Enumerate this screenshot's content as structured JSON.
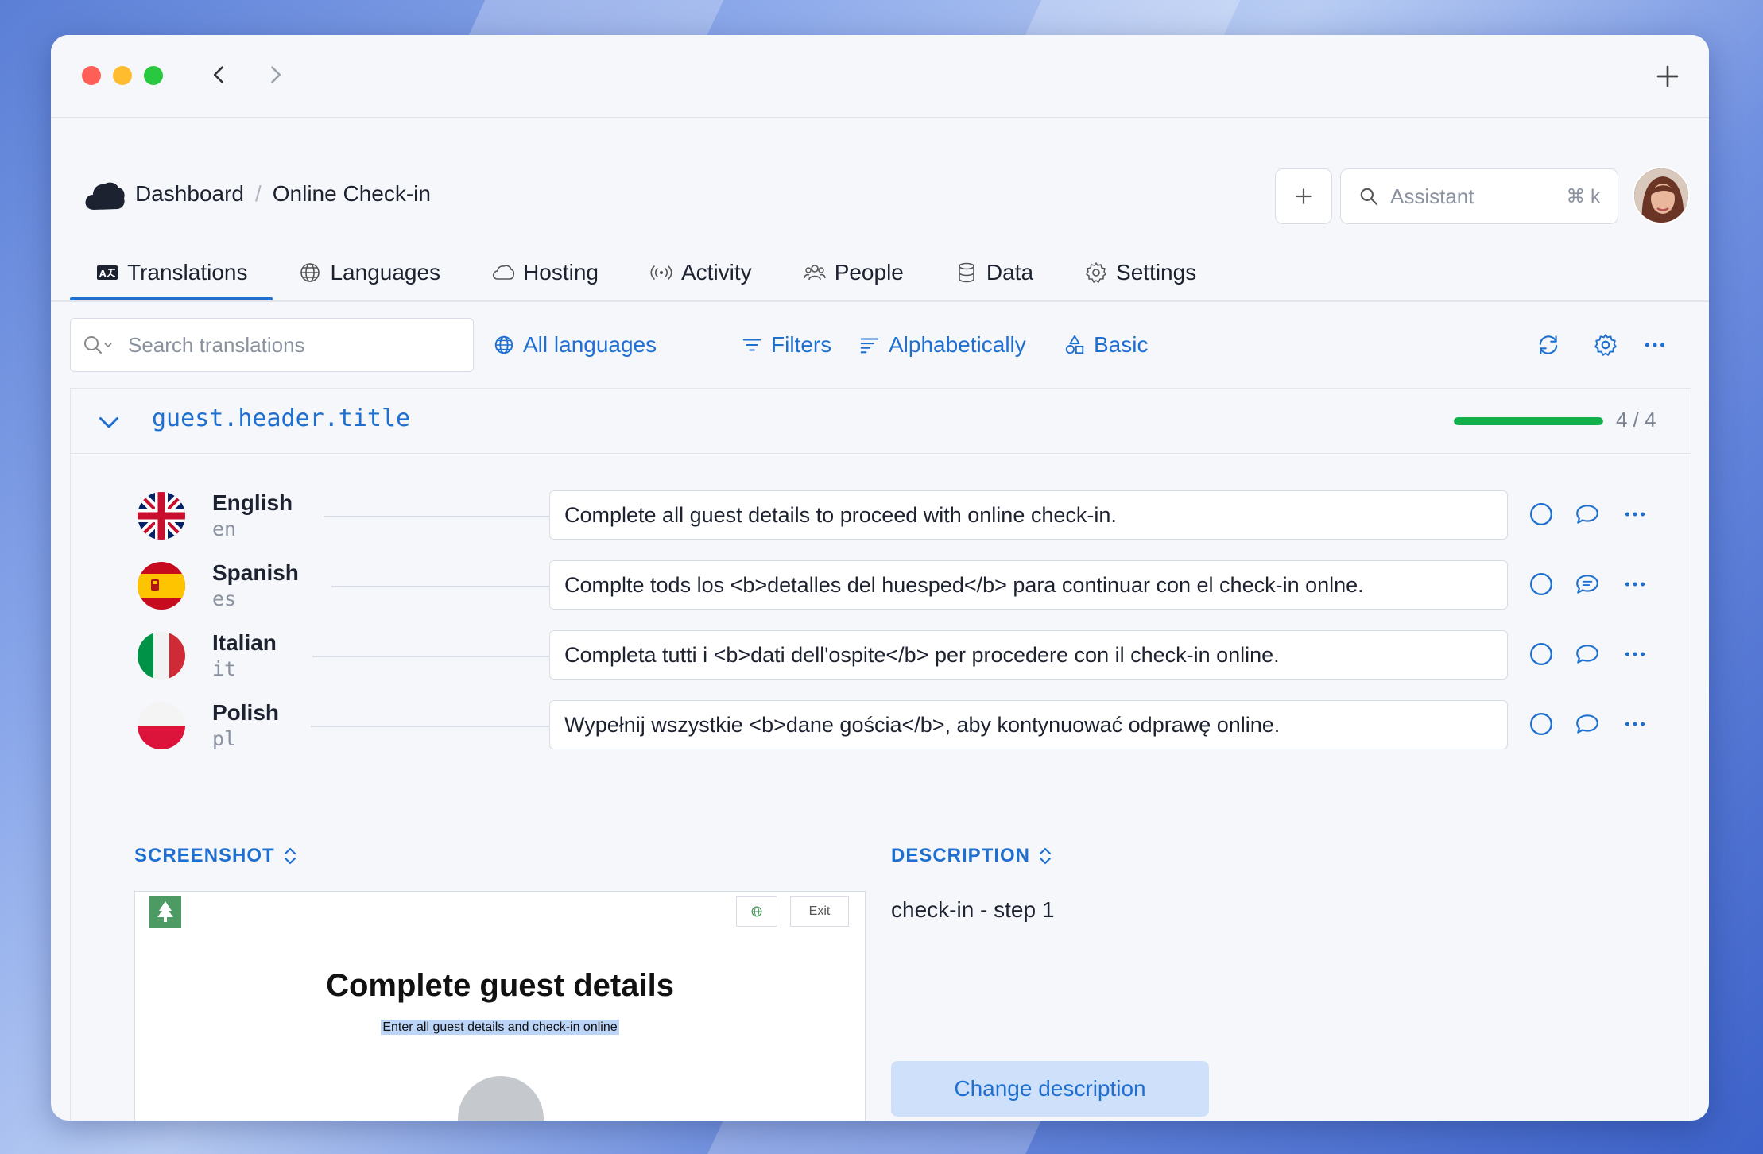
{
  "window": {
    "controls": [
      "close",
      "minimize",
      "zoom"
    ],
    "nav": {
      "back_icon": "chevron-left-icon",
      "forward_icon": "chevron-right-icon"
    },
    "new_tab_icon": "plus-icon"
  },
  "header": {
    "breadcrumb": {
      "root": "Dashboard",
      "separator": "/",
      "current": "Online Check-in"
    },
    "assistant": {
      "placeholder": "Assistant",
      "shortcut": "⌘ k"
    }
  },
  "tabs": [
    {
      "label": "Translations",
      "icon": "translate-icon",
      "active": true
    },
    {
      "label": "Languages",
      "icon": "globe-icon"
    },
    {
      "label": "Hosting",
      "icon": "cloud-icon"
    },
    {
      "label": "Activity",
      "icon": "broadcast-icon"
    },
    {
      "label": "People",
      "icon": "people-icon"
    },
    {
      "label": "Data",
      "icon": "database-icon"
    },
    {
      "label": "Settings",
      "icon": "gear-icon"
    }
  ],
  "toolbar": {
    "search_placeholder": "Search translations",
    "languages": "All languages",
    "filters": "Filters",
    "sort": "Alphabetically",
    "view": "Basic"
  },
  "key": {
    "name": "guest.header.title",
    "progress_text": "4 / 4",
    "progress_fraction": 1.0,
    "progress_color": "#12b04a",
    "rows": [
      {
        "language": "English",
        "code": "en",
        "flag": "uk-flag-icon",
        "text": "Complete all guest details to proceed with online check-in."
      },
      {
        "language": "Spanish",
        "code": "es",
        "flag": "spain-flag-icon",
        "text": "Complte tods los <b>detalles del huesped</b> para continuar con el check-in onlne."
      },
      {
        "language": "Italian",
        "code": "it",
        "flag": "italy-flag-icon",
        "text": "Completa tutti i <b>dati dell'ospite</b> per procedere con il check-in online."
      },
      {
        "language": "Polish",
        "code": "pl",
        "flag": "poland-flag-icon",
        "text": "Wypełnij wszystkie <b>dane gościa</b>, aby kontynuować odprawę online."
      }
    ]
  },
  "screenshot": {
    "label": "SCREENSHOT",
    "preview_exit": "Exit",
    "preview_title": "Complete guest details",
    "preview_subtitle": "Enter all guest details and check-in online"
  },
  "description": {
    "label": "DESCRIPTION",
    "text": "check-in - step 1",
    "change_button": "Change description"
  },
  "colors": {
    "accent": "#1f6fd1",
    "background": "#f5f7fa"
  }
}
